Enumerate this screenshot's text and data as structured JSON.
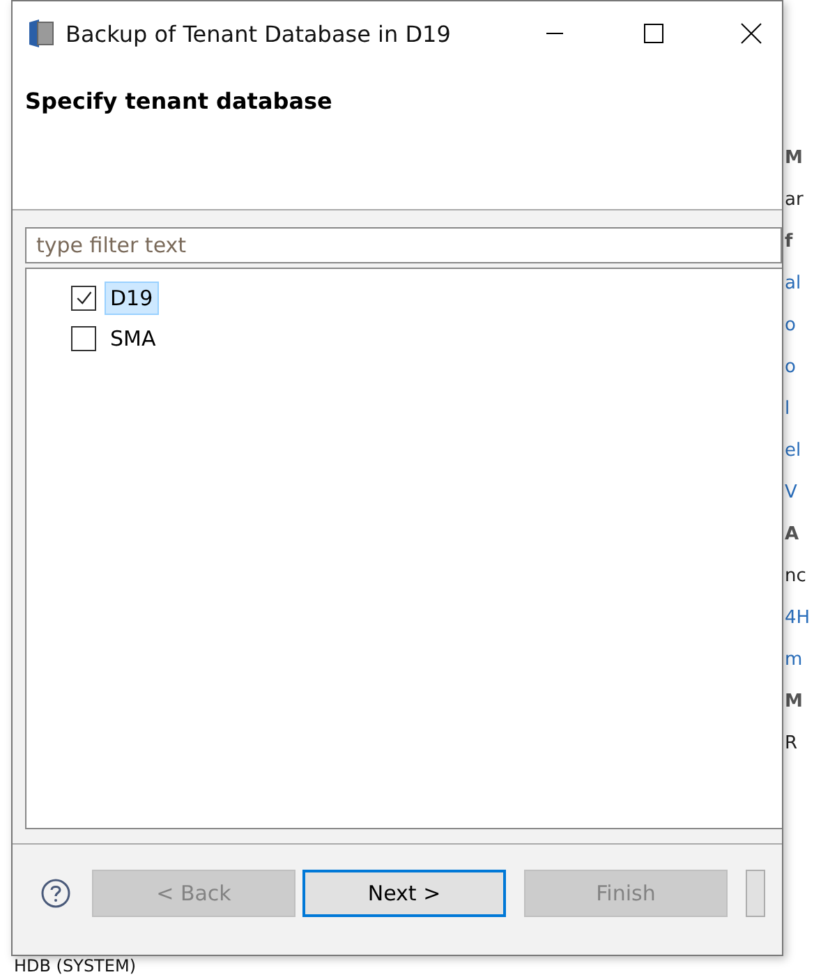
{
  "background": {
    "right_fragments": [
      {
        "text": "M",
        "kind": "heading"
      },
      {
        "text": "ar",
        "kind": "text"
      },
      {
        "text": "f",
        "kind": "heading"
      },
      {
        "text": "al",
        "kind": "link"
      },
      {
        "text": "o",
        "kind": "link"
      },
      {
        "text": "o",
        "kind": "link"
      },
      {
        "text": "l",
        "kind": "link"
      },
      {
        "text": "el",
        "kind": "link"
      },
      {
        "text": "V",
        "kind": "link"
      },
      {
        "text": "A",
        "kind": "heading"
      },
      {
        "text": "nc",
        "kind": "text"
      },
      {
        "text": "4H",
        "kind": "link"
      },
      {
        "text": "m",
        "kind": "link"
      },
      {
        "text": "M",
        "kind": "heading"
      },
      {
        "text": "R",
        "kind": "text"
      }
    ],
    "bottom_text": "HDB (SYSTEM)"
  },
  "window": {
    "title": "Backup of Tenant Database in D19"
  },
  "page_title": "Specify tenant database",
  "filter": {
    "placeholder": "type filter text"
  },
  "databases": [
    {
      "name": "D19",
      "checked": true,
      "selected": true
    },
    {
      "name": "SMA",
      "checked": false,
      "selected": false
    }
  ],
  "buttons": [
    {
      "label": "< Back",
      "disabled": true,
      "focused": false
    },
    {
      "label": "Next >",
      "disabled": false,
      "focused": true
    },
    {
      "label": "Finish",
      "disabled": true,
      "focused": false
    },
    {
      "disabled": false,
      "focused": false
    }
  ]
}
